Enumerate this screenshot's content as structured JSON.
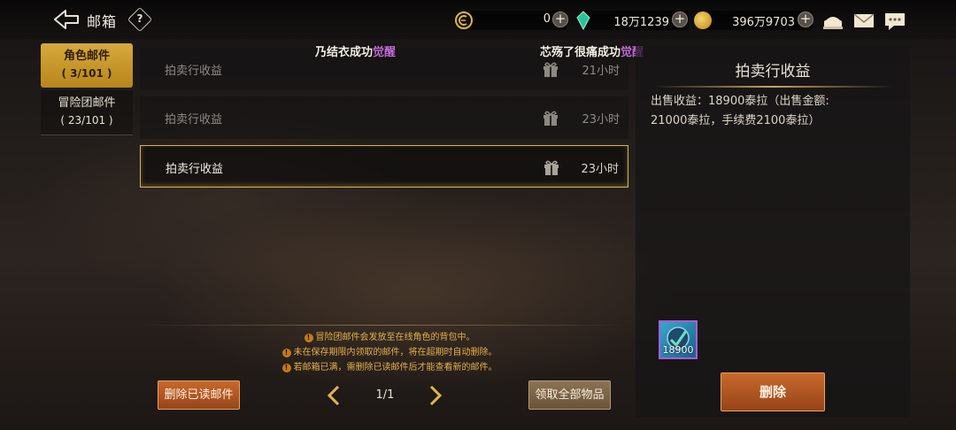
{
  "header": {
    "title": "邮箱",
    "help_label": "?",
    "currencies": [
      {
        "name": "currency-c",
        "value": "0",
        "color": "#d9b44a"
      },
      {
        "name": "gem",
        "value": "18万1239",
        "color": "#29c39b"
      },
      {
        "name": "gold-coin",
        "value": "396万9703",
        "color": "#e3b23a"
      }
    ],
    "plus_label": "+"
  },
  "tabs": [
    {
      "label": "角色邮件",
      "count": "( 3/101 )",
      "active": true
    },
    {
      "label": "冒险团邮件",
      "count": "( 23/101 )",
      "active": false
    }
  ],
  "notices": [
    {
      "text": "乃结衣成功",
      "highlight": "觉醒"
    },
    {
      "text": "芯殇了很痛成功",
      "highlight": "觉醒"
    }
  ],
  "mails": [
    {
      "title": "拍卖行收益",
      "time": "21小时",
      "selected": false
    },
    {
      "title": "拍卖行收益",
      "time": "23小时",
      "selected": false
    },
    {
      "title": "拍卖行收益",
      "time": "23小时",
      "selected": true
    }
  ],
  "tips": [
    "冒险团邮件会发放至在线角色的背包中。",
    "未在保存期限内领取的邮件，将在超期时自动删除。",
    "若邮箱已满，需删除已读邮件后才能查看新的邮件。"
  ],
  "tip_bang": "!",
  "actions": {
    "delete_read": "删除已读邮件",
    "claim_all": "领取全部物品"
  },
  "pagination": {
    "current": "1/1"
  },
  "detail": {
    "title": "拍卖行收益",
    "body": "出售收益：18900泰拉（出售金额: 21000泰拉，手续费2100泰拉）",
    "item_qty": "18900",
    "delete_label": "删除"
  }
}
